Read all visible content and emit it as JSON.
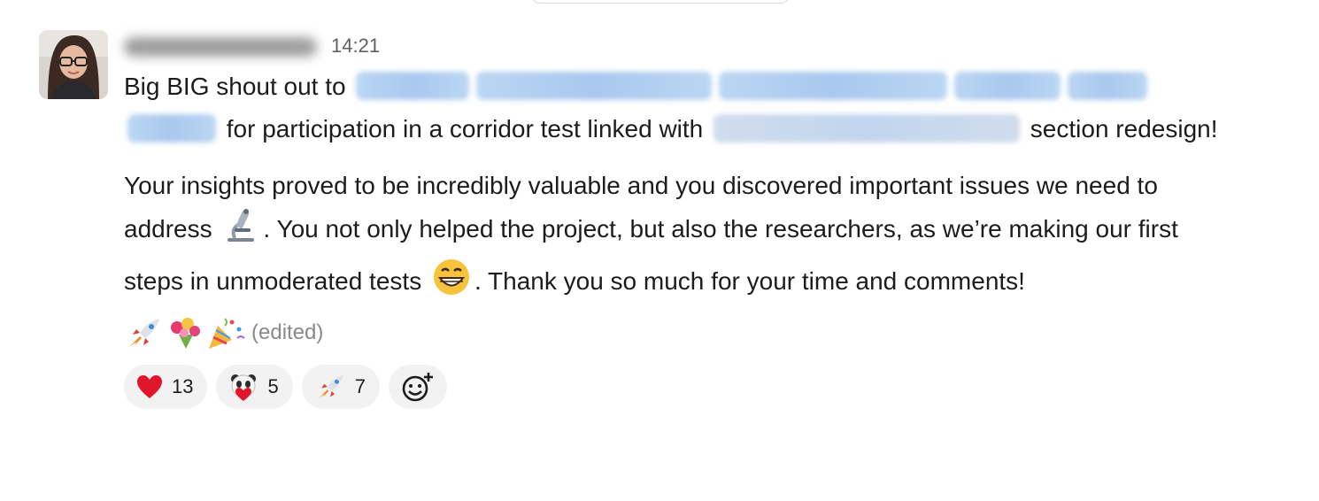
{
  "message": {
    "time": "14:21",
    "paragraph1": {
      "lead": "Big BIG shout out to ",
      "middle": " for participation in a corridor test linked with ",
      "tail": " section redesign!"
    },
    "paragraph2": {
      "part1": "Your insights proved to be incredibly valuable and you discovered  important issues we need to address ",
      "part2": ". You not only helped the project, but also the researchers, as we’re making our first steps in unmoderated tests ",
      "part3": ". Thank you so much for your time and comments!"
    },
    "edited_label": "(edited)",
    "inline_emoji": [
      "microscope-icon",
      "grinning-face-icon"
    ],
    "trailing_emoji": [
      "rocket-icon",
      "bouquet-icon",
      "party-popper-icon"
    ]
  },
  "reactions": [
    {
      "emoji": "heart-icon",
      "count": "13"
    },
    {
      "emoji": "panda-heart-icon",
      "count": "5"
    },
    {
      "emoji": "rocket-icon",
      "count": "7"
    }
  ],
  "colors": {
    "mention_bg": "#bad6f2",
    "reaction_bg": "#f2f2f2",
    "timestamp": "#616061"
  }
}
